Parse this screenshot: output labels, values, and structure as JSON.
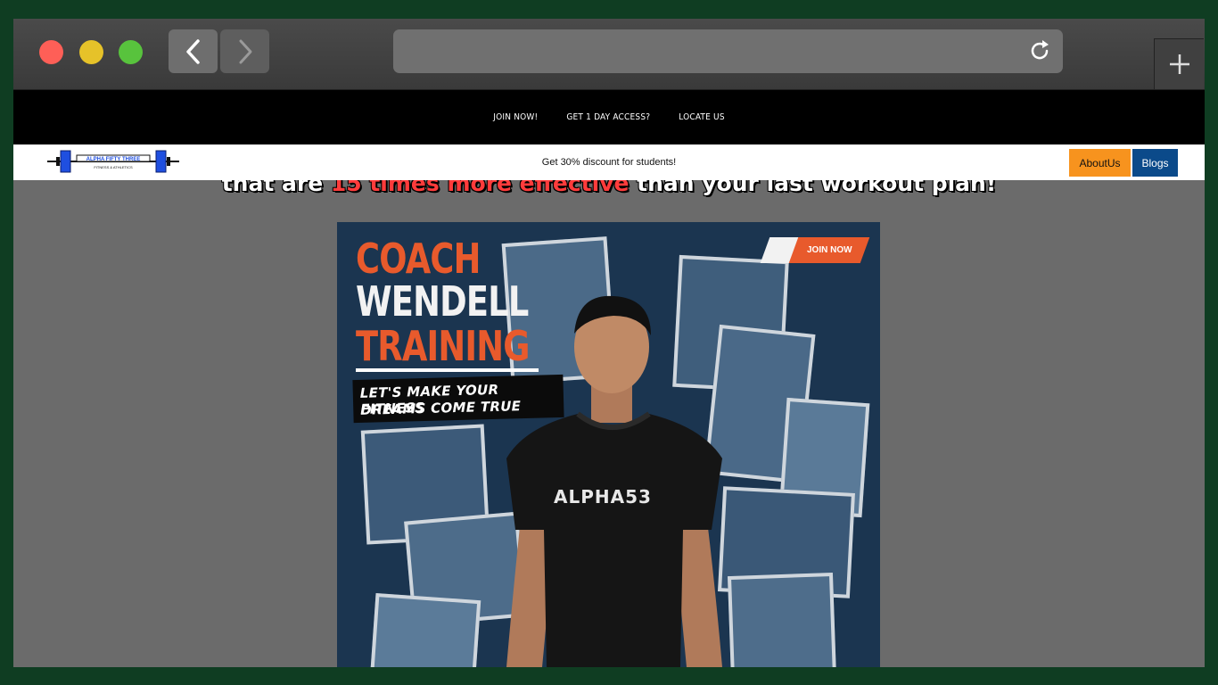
{
  "nav": {
    "items": [
      "JOIN NOW!",
      "GET 1 DAY ACCESS?",
      "LOCATE US"
    ]
  },
  "promo": {
    "text": "Get 30% discount for students!",
    "about_label": "AboutUs",
    "blogs_label": "Blogs",
    "logo_text": "ALPHA FIFTY THREE",
    "logo_subtext": "FITNESS & ATHLETICS"
  },
  "headline": {
    "before": "that are ",
    "highlight": "15 times more effective",
    "after": " than your last workout plan!"
  },
  "poster": {
    "title_1": "COACH",
    "title_2": "WENDELL",
    "title_3": "TRAINING",
    "tag_line_1": "LET'S MAKE YOUR FITNESS",
    "tag_line_2": "DREAMS COME TRUE",
    "join_label": "JOIN NOW",
    "shirt_brand": "ALPHA53"
  },
  "colors": {
    "accent_orange": "#f7931e",
    "blogs_blue": "#0b4a8a",
    "highlight_red": "#ff3b3b",
    "poster_orange": "#e85a2c"
  }
}
